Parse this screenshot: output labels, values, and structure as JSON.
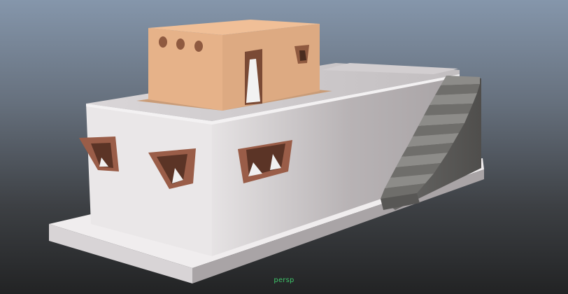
{
  "viewport": {
    "camera_name": "persp",
    "background_top_color": "#7e8fa6",
    "background_bottom_color": "#232425",
    "label_color": "#3fc46a"
  },
  "model": {
    "wall_color": "#e8e4e6",
    "roof_color": "#c9c5c8",
    "base_color": "#d5d1d3",
    "stair_color": "#5f5e5c",
    "room_color": "#e2ae84",
    "window_color": "#9a5d48"
  },
  "icons": {
    "house_model": "house-model"
  }
}
